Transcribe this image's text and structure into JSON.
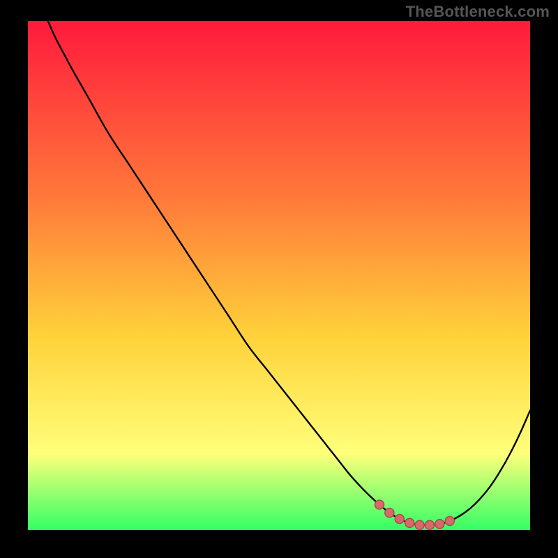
{
  "attribution": "TheBottleneck.com",
  "colors": {
    "frame": "#000000",
    "curve": "#000000",
    "markers_fill": "#d56a6a",
    "markers_stroke": "#b04848",
    "grad_top": "#ff1a3c",
    "grad_mid1": "#ff7a3a",
    "grad_mid2": "#ffd23a",
    "grad_mid3": "#ffff7a",
    "grad_bottom": "#33ff66"
  },
  "chart_data": {
    "type": "line",
    "title": "",
    "xlabel": "",
    "ylabel": "",
    "xlim": [
      0,
      100
    ],
    "ylim": [
      0,
      100
    ],
    "x": [
      0,
      4,
      8,
      12,
      16,
      20,
      24,
      28,
      32,
      36,
      40,
      44,
      48,
      52,
      56,
      60,
      62,
      64,
      66,
      68,
      70,
      72,
      74,
      76,
      78,
      80,
      82,
      84,
      86,
      88,
      90,
      92,
      94,
      96,
      98,
      100
    ],
    "values": [
      112,
      100,
      92,
      85,
      78,
      72,
      66,
      60,
      54,
      48,
      42,
      36,
      31,
      26,
      21,
      16,
      13.5,
      11,
      8.8,
      6.8,
      5.0,
      3.4,
      2.2,
      1.4,
      1.0,
      1.0,
      1.2,
      1.8,
      2.8,
      4.2,
      6.1,
      8.5,
      11.5,
      15.0,
      19.0,
      23.5
    ],
    "marker_points": [
      {
        "x": 70,
        "y": 5.0
      },
      {
        "x": 72,
        "y": 3.4
      },
      {
        "x": 74,
        "y": 2.2
      },
      {
        "x": 76,
        "y": 1.4
      },
      {
        "x": 78,
        "y": 1.0
      },
      {
        "x": 80,
        "y": 1.0
      },
      {
        "x": 82,
        "y": 1.2
      },
      {
        "x": 84,
        "y": 1.8
      }
    ]
  }
}
